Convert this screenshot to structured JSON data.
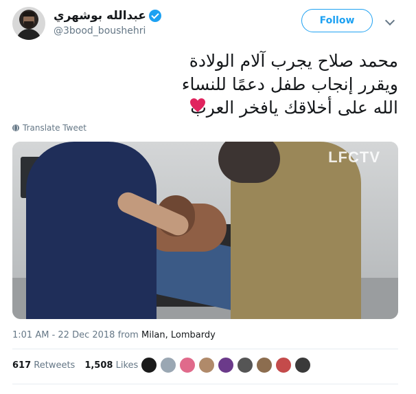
{
  "author": {
    "display_name": "عبدالله بوشهري",
    "handle": "@3bood_boushehri",
    "verified": true
  },
  "actions": {
    "follow_label": "Follow"
  },
  "tweet": {
    "lines": [
      "محمد صلاح يجرب آلام الولادة",
      "ويقرر إنجاب طفل دعمًا للنساء",
      "الله على أخلاقك يافخر العرب"
    ],
    "emoji": "red-heart-icon"
  },
  "translate_label": "Translate Tweet",
  "media": {
    "watermark": "LFCTV"
  },
  "meta": {
    "time": "1:01 AM - 22 Dec 2018",
    "from_word": "from",
    "place": "Milan, Lombardy"
  },
  "stats": {
    "retweets_count": "617",
    "retweets_label": "Retweets",
    "likes_count": "1,508",
    "likes_label": "Likes"
  },
  "likers": [
    {
      "color": "#1a1a1a"
    },
    {
      "color": "#9aa7b3"
    },
    {
      "color": "#e06a8b"
    },
    {
      "color": "#b08a6a"
    },
    {
      "color": "#6b3a8a"
    },
    {
      "color": "#555555"
    },
    {
      "color": "#8c6d4f"
    },
    {
      "color": "#c44b4b"
    },
    {
      "color": "#3a3a3a"
    }
  ],
  "colors": {
    "accent": "#1da1f2",
    "heart": "#e0245e"
  }
}
